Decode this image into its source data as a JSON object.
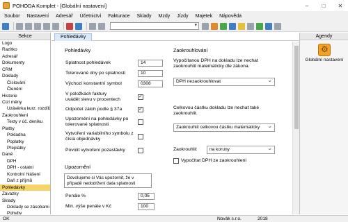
{
  "window": {
    "title": "POHODA Komplet - [Globální nastavení]"
  },
  "menu": [
    "Soubor",
    "Nastavení",
    "Adresář",
    "Účetnictví",
    "Fakturace",
    "Sklady",
    "Mzdy",
    "Jízdy",
    "Majetek",
    "Nápověda"
  ],
  "sections": {
    "header": "Sekce",
    "items": [
      {
        "label": "Logo",
        "level": 0
      },
      {
        "label": "Razítko",
        "level": 0
      },
      {
        "label": "Adresář",
        "level": 0
      },
      {
        "label": "Dokumenty",
        "level": 0
      },
      {
        "label": "CRM",
        "level": 0
      },
      {
        "label": "Doklady",
        "level": 0
      },
      {
        "label": "Číslování",
        "level": 1
      },
      {
        "label": "Členění",
        "level": 1
      },
      {
        "label": "Historie",
        "level": 0
      },
      {
        "label": "Cizí měny",
        "level": 0
      },
      {
        "label": "Uzávěrka kurz. rozdílů",
        "level": 1
      },
      {
        "label": "Zaokrouhlení",
        "level": 0
      },
      {
        "label": "Texty v úč. deníku",
        "level": 1
      },
      {
        "label": "Platby",
        "level": 0
      },
      {
        "label": "Pokladna",
        "level": 1
      },
      {
        "label": "Poplatky",
        "level": 1
      },
      {
        "label": "Přeplatky",
        "level": 1
      },
      {
        "label": "Daně",
        "level": 0
      },
      {
        "label": "DPH",
        "level": 1
      },
      {
        "label": "DPH - ostatní",
        "level": 1
      },
      {
        "label": "Kontrolní hlášení",
        "level": 1
      },
      {
        "label": "Daň z příjmů",
        "level": 1
      },
      {
        "label": "Pohledávky",
        "level": 0,
        "selected": true
      },
      {
        "label": "Závazky",
        "level": 0
      },
      {
        "label": "Sklady",
        "level": 0
      },
      {
        "label": "Doklady se zásobami",
        "level": 1
      },
      {
        "label": "Pohyby",
        "level": 1
      }
    ]
  },
  "tab": {
    "label": "Pohledávky"
  },
  "form": {
    "left_title": "Pohledávky",
    "splatnost_label": "Splatnost pohledávek",
    "splatnost_value": "14",
    "tolerovane_label": "Tolerované dny po splatnosti",
    "tolerovane_value": "10",
    "vychozi_label": "Výchozí konstantní symbol",
    "vychozi_value": "0308",
    "polozky_label": "V položkách faktury\nuvádět slevu v procentech",
    "polozky_checked": true,
    "odpocet_label": "Odpočet záloh podle § 37a",
    "odpocet_checked": true,
    "upozorneni_label": "Upozornění na pohledávky po\ntolerované splatnosti",
    "upozorneni_checked": false,
    "vytvoreni_label": "Vytvoření variabilního symbolu z\nčísla objednávky",
    "vytvoreni_checked": false,
    "povolit_label": "Povolit vytvoření pozastávky",
    "povolit_checked": false,
    "upozorneni_title": "Upozornění",
    "upozorneni_text": "Dovolujeme si Vás upozornit, že v\npřípadě nedodržení data splatnosti",
    "penale_label": "Penále %",
    "penale_value": "0,05",
    "min_penale_label": "Min. výše penále v Kč",
    "min_penale_value": "100",
    "right_title": "Zaokrouhlování",
    "dph_text": "Vypočítanou DPH na dokladu lze nechat\nzaokrouhlit matematicky dle zákona.",
    "dph_combo": "DPH nezaokrouhlovat",
    "celkova_text": "Celkovou částku dokladu lze nechat také\nzaokrouhlit.",
    "celkova_combo": "Zaokrouhlit celkovou částku matematicky",
    "zaokrouhlit_label": "Zaokrouhlit",
    "zaokrouhlit_combo": "na koruny",
    "vypocitat_label": "Vypočítat DPH ze zaokrouhlení",
    "vypocitat_checked": false
  },
  "agendy": {
    "header": "Agendy",
    "item_label": "Globální nastavení"
  },
  "status": {
    "left": "OK",
    "company": "Novák s.r.o.",
    "year": "2018"
  }
}
